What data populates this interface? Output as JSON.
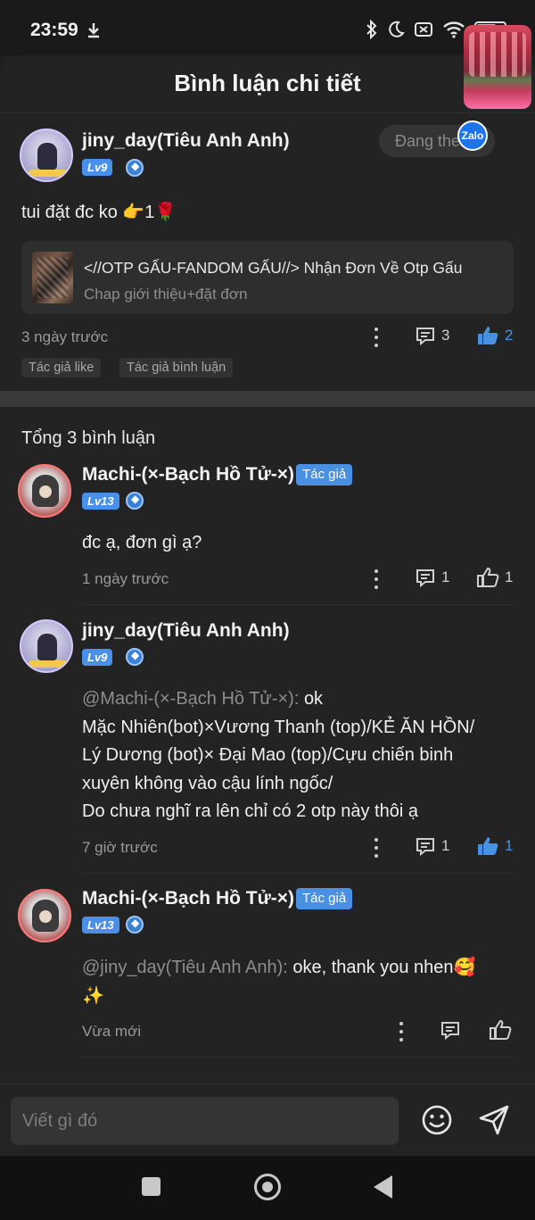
{
  "status_bar": {
    "time": "23:59",
    "battery": "72",
    "battery_level_percent": 72
  },
  "sheet": {
    "title": "Bình luận chi tiết"
  },
  "main_comment": {
    "username": "jiny_day(Tiêu Anh Anh)",
    "level": "Lv9",
    "follow_label": "Đang the",
    "text": "tui đặt đc ko 👉1🌹",
    "post": {
      "title": "<//OTP GẤU-FANDOM GẤU//> Nhận Đơn Về Otp Gấu",
      "subtitle": "Chap giới thiệu+đặt đơn"
    },
    "time": "3 ngày trước",
    "reply_count": "3",
    "like_count": "2",
    "tags": [
      "Tác giả like",
      "Tác giả bình luận"
    ]
  },
  "floating_widget": {
    "badge": "Zalo"
  },
  "replies_header": "Tổng 3 bình luận",
  "replies": [
    {
      "username": "Machi-(×-Bạch Hồ Tử-×)",
      "author_tag": "Tác giả",
      "level": "Lv13",
      "quote": "",
      "lines": [
        "đc ạ, đơn gì ạ?"
      ],
      "time": "1 ngày trước",
      "reply_count": "1",
      "like_count": "1"
    },
    {
      "username": "jiny_day(Tiêu Anh Anh)",
      "level": "Lv9",
      "quote": "@Machi-(×-Bạch Hồ Tử-×): ",
      "quote_text": "ok",
      "lines": [
        "Mặc Nhiên(bot)×Vương Thanh (top)/KẺ ĂN HỒN/",
        "Lý Dương (bot)× Đại Mao (top)/Cựu chiến binh",
        "xuyên không vào cậu lính ngốc/",
        "Do chưa nghĩ ra lên chỉ có 2 otp này thôi ạ"
      ],
      "time": "7 giờ trước",
      "reply_count": "1",
      "like_count": "1"
    },
    {
      "username": "Machi-(×-Bạch Hồ Tử-×)",
      "author_tag": "Tác giả",
      "level": "Lv13",
      "quote": "@jiny_day(Tiêu Anh Anh): ",
      "quote_text": "oke, thank you nhen🥰",
      "lines": [
        "✨"
      ],
      "time": "Vừa mới",
      "reply_count": "",
      "like_count": ""
    }
  ],
  "input": {
    "placeholder": "Viết gì đó"
  },
  "icons": [
    "download-icon",
    "bluetooth-icon",
    "moon-icon",
    "sim-icon",
    "wifi-icon",
    "battery-icon",
    "more-icon",
    "comment-icon",
    "thumbs-up-icon",
    "emoji-icon",
    "send-icon",
    "nav-recent-icon",
    "nav-home-icon",
    "nav-back-icon"
  ],
  "colors": {
    "accent": "#4a90e2",
    "background": "#232323",
    "muted_text": "#9a9a9a"
  }
}
